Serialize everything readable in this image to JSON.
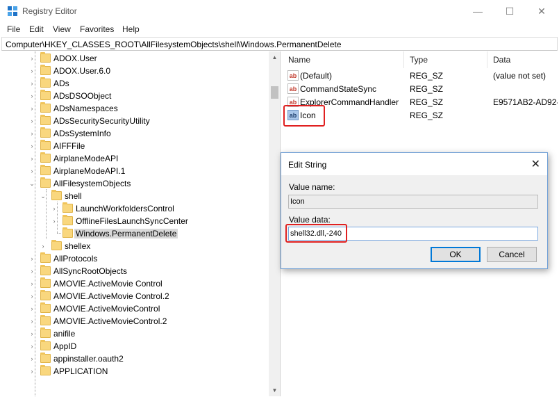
{
  "window": {
    "title": "Registry Editor",
    "minimize": "—",
    "maximize": "☐",
    "close": "✕"
  },
  "menu": [
    "File",
    "Edit",
    "View",
    "Favorites",
    "Help"
  ],
  "address": "Computer\\HKEY_CLASSES_ROOT\\AllFilesystemObjects\\shell\\Windows.PermanentDelete",
  "tree": [
    {
      "label": "ADOX.User"
    },
    {
      "label": "ADOX.User.6.0"
    },
    {
      "label": "ADs"
    },
    {
      "label": "ADsDSOObject"
    },
    {
      "label": "ADsNamespaces"
    },
    {
      "label": "ADsSecuritySecurityUtility"
    },
    {
      "label": "ADsSystemInfo"
    },
    {
      "label": "AIFFFile"
    },
    {
      "label": "AirplaneModeAPI"
    },
    {
      "label": "AirplaneModeAPI.1"
    },
    {
      "label": "AllFilesystemObjects"
    },
    {
      "label": "shell"
    },
    {
      "label": "LaunchWorkfoldersControl"
    },
    {
      "label": "OfflineFilesLaunchSyncCenter"
    },
    {
      "label": "Windows.PermanentDelete"
    },
    {
      "label": "shellex"
    },
    {
      "label": "AllProtocols"
    },
    {
      "label": "AllSyncRootObjects"
    },
    {
      "label": "AMOVIE.ActiveMovie Control"
    },
    {
      "label": "AMOVIE.ActiveMovie Control.2"
    },
    {
      "label": "AMOVIE.ActiveMovieControl"
    },
    {
      "label": "AMOVIE.ActiveMovieControl.2"
    },
    {
      "label": "anifile"
    },
    {
      "label": "AppID"
    },
    {
      "label": "appinstaller.oauth2"
    },
    {
      "label": "APPLICATION"
    }
  ],
  "list": {
    "columns": [
      "Name",
      "Type",
      "Data"
    ],
    "rows": [
      {
        "icon": "ab",
        "name": "(Default)",
        "type": "REG_SZ",
        "data": "(value not set)"
      },
      {
        "icon": "ab",
        "name": "CommandStateSync",
        "type": "REG_SZ",
        "data": ""
      },
      {
        "icon": "ab",
        "name": "ExplorerCommandHandler",
        "type": "REG_SZ",
        "data": "E9571AB2-AD92-"
      },
      {
        "icon": "ab",
        "name": "Icon",
        "type": "REG_SZ",
        "data": ""
      }
    ]
  },
  "dialog": {
    "title": "Edit String",
    "close": "✕",
    "value_name_label": "Value name:",
    "value_name": "Icon",
    "value_data_label": "Value data:",
    "value_data": "shell32.dll,-240",
    "ok": "OK",
    "cancel": "Cancel"
  },
  "colors": {
    "highlight": "#e02020",
    "accent": "#0078d7",
    "folder": "#f9d77e"
  }
}
